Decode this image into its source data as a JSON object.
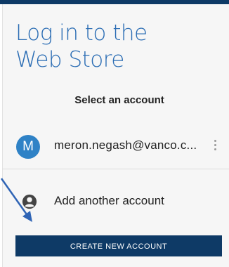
{
  "header": {
    "title_line1": "Log in to the",
    "title_line2": "Web Store"
  },
  "account_picker": {
    "heading": "Select an account",
    "account": {
      "avatar_initial": "M",
      "email": "meron.negash@vanco.c..."
    },
    "add_account_label": "Add another account"
  },
  "actions": {
    "create_account_label": "CREATE NEW ACCOUNT"
  },
  "colors": {
    "accent": "#2b6db4",
    "button": "#0e3a66",
    "avatar": "#2f82c6",
    "arrow": "#2f64b5"
  },
  "icons": {
    "account_menu": "more-vert-icon",
    "add_account": "person-circle-icon",
    "annotation": "arrow-icon"
  }
}
